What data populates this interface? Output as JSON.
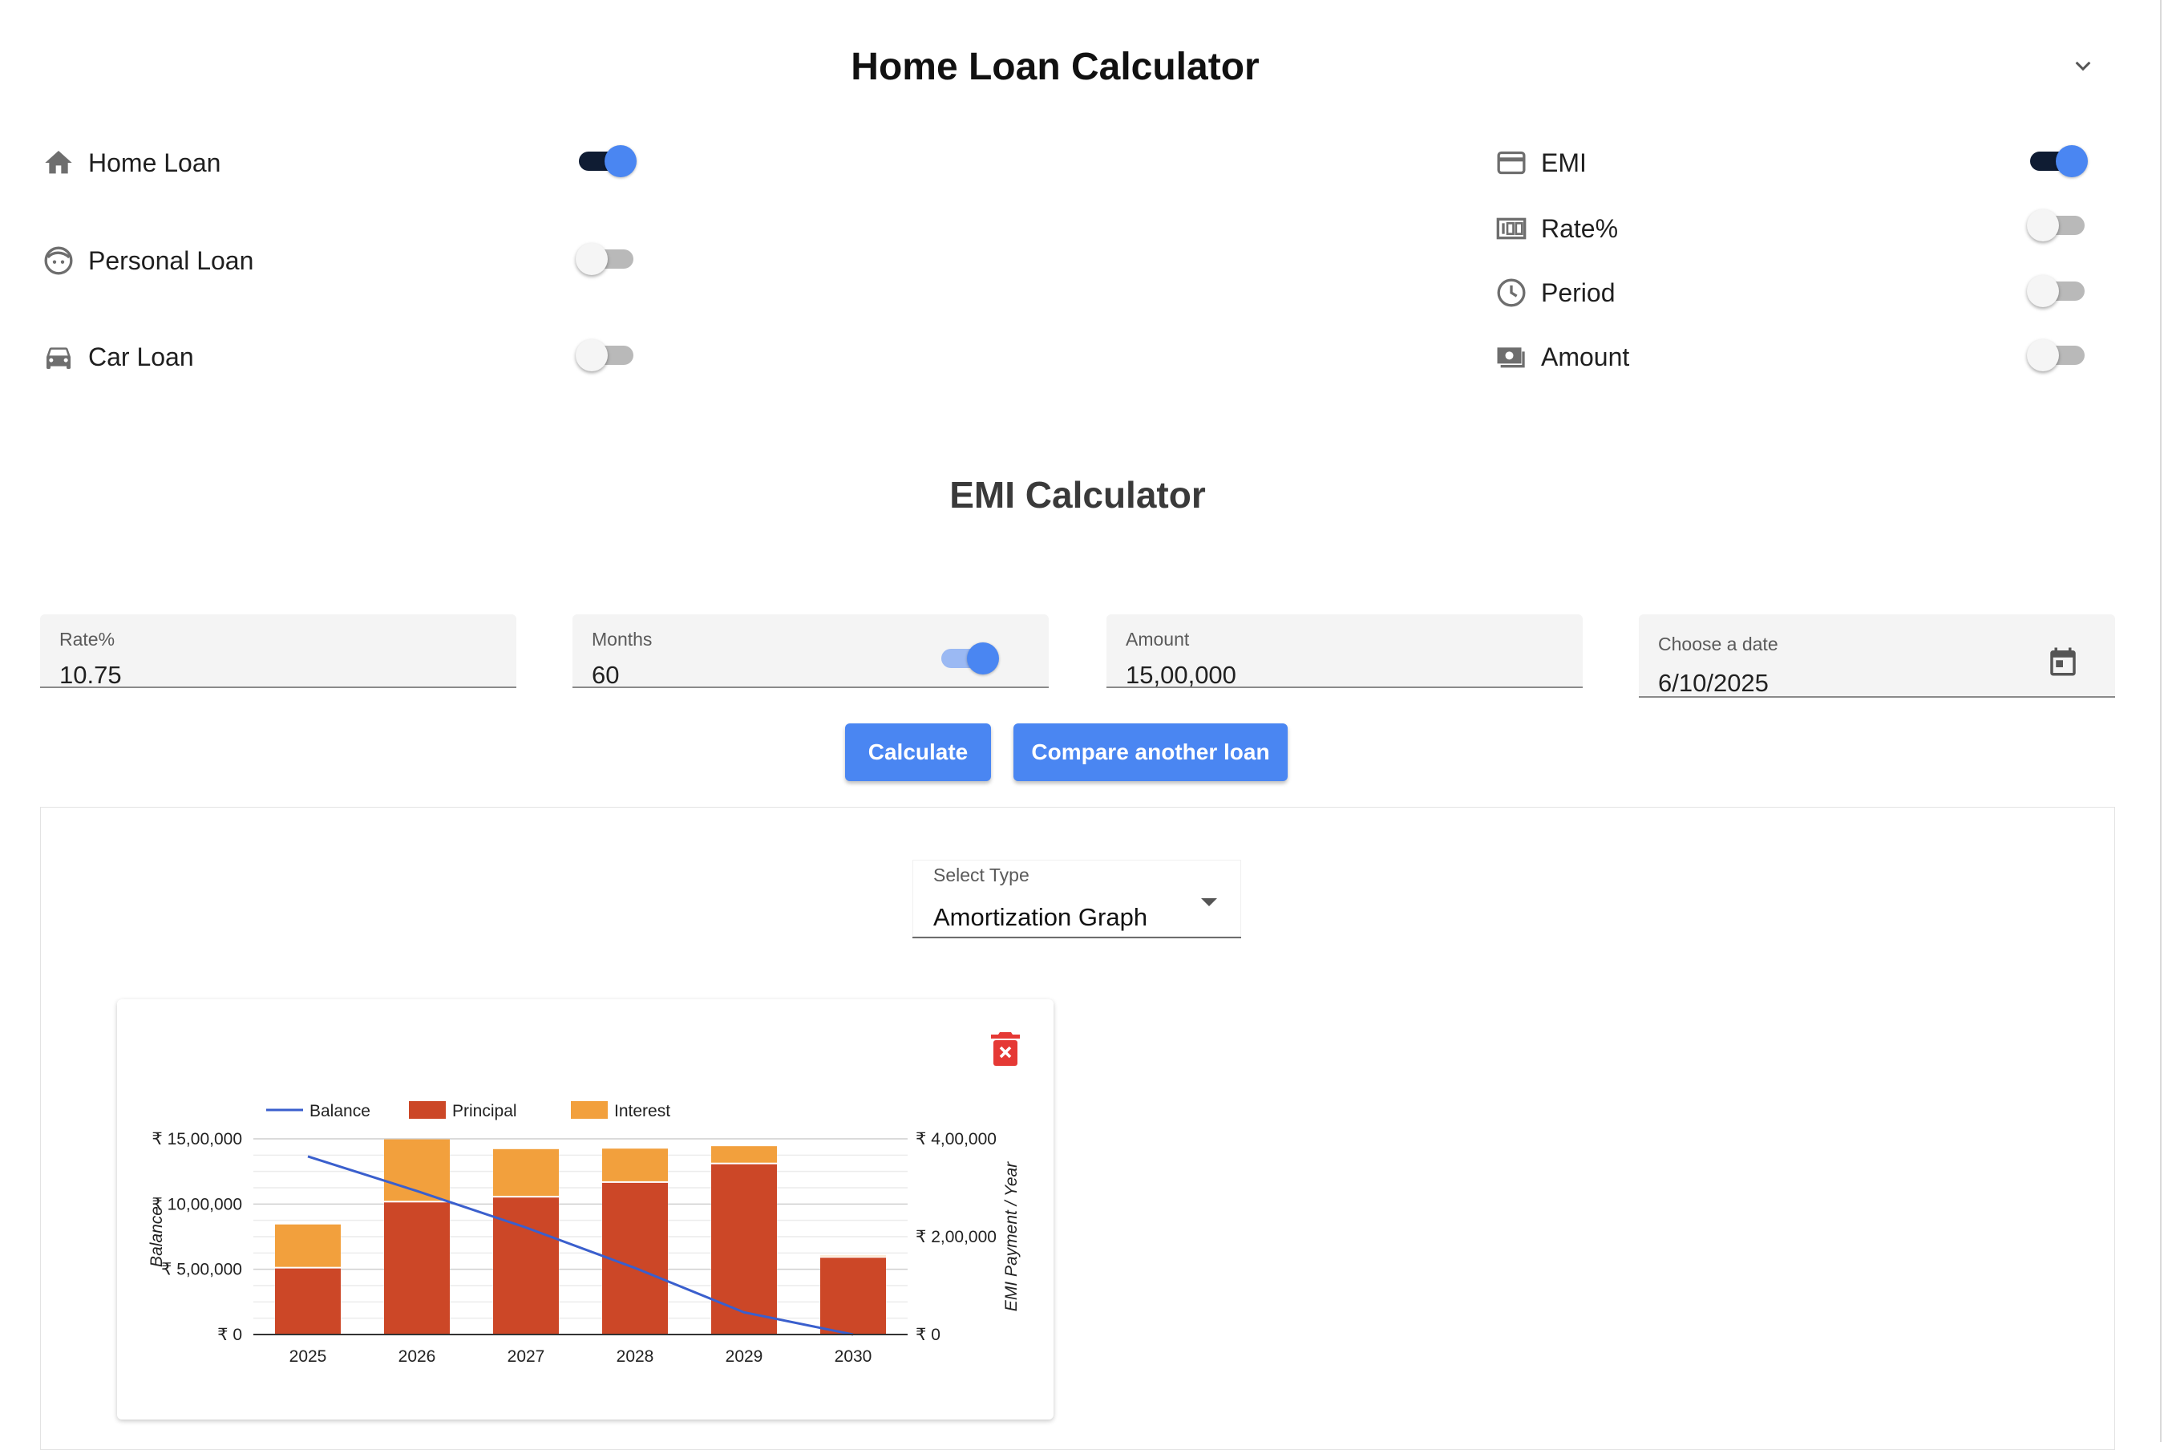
{
  "header": {
    "title": "Home Loan Calculator"
  },
  "loan_types": [
    {
      "label": "Home Loan",
      "icon": "home-icon",
      "enabled": true
    },
    {
      "label": "Personal Loan",
      "icon": "face-icon",
      "enabled": false
    },
    {
      "label": "Car Loan",
      "icon": "car-icon",
      "enabled": false
    }
  ],
  "calc_modes": [
    {
      "label": "EMI",
      "icon": "credit-card-icon",
      "enabled": true
    },
    {
      "label": "Rate%",
      "icon": "percent-counter-icon",
      "enabled": false
    },
    {
      "label": "Period",
      "icon": "clock-icon",
      "enabled": false
    },
    {
      "label": "Amount",
      "icon": "cash-icon",
      "enabled": false
    }
  ],
  "emi": {
    "title": "EMI Calculator",
    "rate": {
      "label": "Rate%",
      "value": "10.75"
    },
    "months": {
      "label": "Months",
      "value": "60",
      "toggle_on": true
    },
    "amount": {
      "label": "Amount",
      "value": "15,00,000"
    },
    "date": {
      "label": "Choose a date",
      "value": "6/10/2025"
    },
    "calculate_label": "Calculate",
    "compare_label": "Compare another loan"
  },
  "results": {
    "select": {
      "label": "Select Type",
      "value": "Amortization Graph"
    }
  },
  "colors": {
    "accent": "#4a86f2",
    "toggle_track_on": "#0f1c33",
    "principal": "#cc4727",
    "interest": "#f2a03d",
    "balance": "#3a5fcd",
    "delete": "#e53935"
  },
  "chart_data": {
    "type": "bar",
    "stacked": true,
    "categories": [
      "2025",
      "2026",
      "2027",
      "2028",
      "2029",
      "2030"
    ],
    "series": [
      {
        "name": "Principal",
        "axis": "right",
        "values": [
          135000,
          270000,
          280000,
          310000,
          348000,
          157000
        ]
      },
      {
        "name": "Interest",
        "axis": "right",
        "values": [
          90000,
          129000,
          99000,
          70000,
          37000,
          4000
        ]
      },
      {
        "name": "Balance",
        "type": "line",
        "axis": "left",
        "values": [
          1365000,
          1100000,
          820000,
          510000,
          170000,
          0
        ]
      }
    ],
    "legend": [
      "Balance",
      "Principal",
      "Interest"
    ],
    "legend_position": "top-left",
    "ylabel_left": "Balance",
    "ylabel_right": "EMI Payment / Year",
    "yticks_left": [
      "₹ 0",
      "₹ 5,00,000",
      "₹ 10,00,000",
      "₹ 15,00,000"
    ],
    "yticks_right": [
      "₹ 0",
      "₹ 2,00,000",
      "₹ 4,00,000"
    ],
    "ylim_left": [
      0,
      1500000
    ],
    "ylim_right": [
      0,
      400000
    ],
    "grid": true
  }
}
